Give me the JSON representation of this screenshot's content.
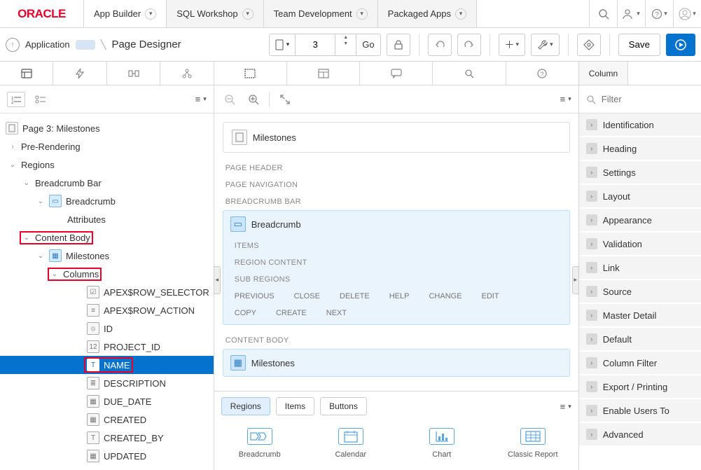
{
  "brand": "ORACLE",
  "nav": {
    "tabs": [
      {
        "label": "App Builder"
      },
      {
        "label": "SQL Workshop"
      },
      {
        "label": "Team Development"
      },
      {
        "label": "Packaged Apps"
      }
    ]
  },
  "breadcrumb": {
    "app": "Application",
    "page": "Page Designer"
  },
  "toolbar": {
    "page_number": "3",
    "go": "Go",
    "save": "Save"
  },
  "left": {
    "page_title": "Page 3: Milestones",
    "nodes": {
      "pre_rendering": "Pre-Rendering",
      "regions": "Regions",
      "breadcrumb_bar": "Breadcrumb Bar",
      "breadcrumb": "Breadcrumb",
      "attributes": "Attributes",
      "content_body": "Content Body",
      "milestones": "Milestones",
      "columns": "Columns",
      "col_apex_row_selector": "APEX$ROW_SELECTOR",
      "col_apex_row_action": "APEX$ROW_ACTION",
      "col_id": "ID",
      "col_project_id": "PROJECT_ID",
      "col_name": "NAME",
      "col_description": "DESCRIPTION",
      "col_due_date": "DUE_DATE",
      "col_created": "CREATED",
      "col_created_by": "CREATED_BY",
      "col_updated": "UPDATED"
    }
  },
  "center": {
    "page_region": "Milestones",
    "sections": {
      "page_header": "PAGE HEADER",
      "page_navigation": "PAGE NAVIGATION",
      "breadcrumb_bar": "BREADCRUMB BAR",
      "content_body": "CONTENT BODY"
    },
    "breadcrumb_region": "Breadcrumb",
    "milestones_region": "Milestones",
    "slots": {
      "items": "ITEMS",
      "region_content": "REGION CONTENT",
      "sub_regions": "SUB REGIONS",
      "previous": "PREVIOUS",
      "close": "CLOSE",
      "delete": "DELETE",
      "help": "HELP",
      "change": "CHANGE",
      "edit": "EDIT",
      "copy": "COPY",
      "create": "CREATE",
      "next": "NEXT"
    },
    "gallery": {
      "tabs": {
        "regions": "Regions",
        "items": "Items",
        "buttons": "Buttons"
      },
      "items": [
        {
          "label": "Breadcrumb"
        },
        {
          "label": "Calendar"
        },
        {
          "label": "Chart"
        },
        {
          "label": "Classic Report"
        }
      ]
    }
  },
  "right": {
    "tab": "Column",
    "filter_placeholder": "Filter",
    "groups": [
      "Identification",
      "Heading",
      "Settings",
      "Layout",
      "Appearance",
      "Validation",
      "Link",
      "Source",
      "Master Detail",
      "Default",
      "Column Filter",
      "Export / Printing",
      "Enable Users To",
      "Advanced"
    ]
  }
}
